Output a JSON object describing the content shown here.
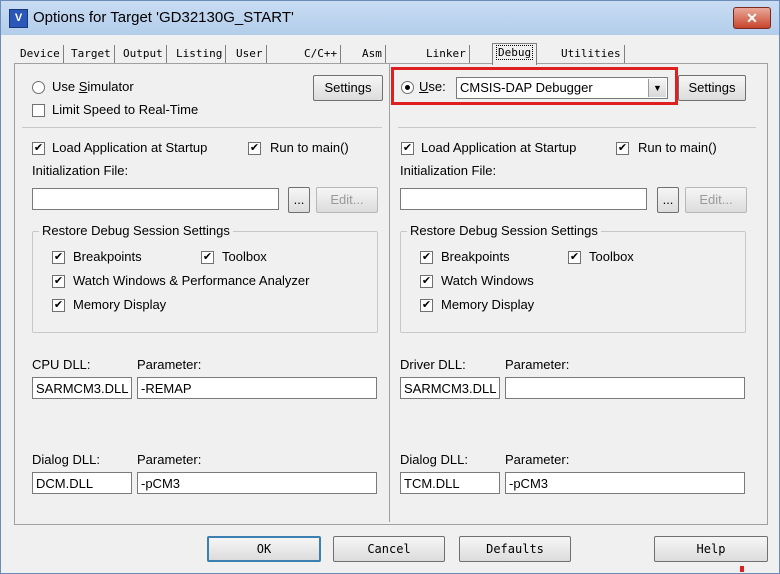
{
  "window": {
    "title": "Options for Target 'GD32130G_START'",
    "close_label": "✕",
    "app_icon_label": "V"
  },
  "tabs": [
    {
      "label": "Device",
      "active": false
    },
    {
      "label": "Target",
      "active": false
    },
    {
      "label": "Output",
      "active": false
    },
    {
      "label": "Listing",
      "active": false
    },
    {
      "label": "User",
      "active": false
    },
    {
      "label": "C/C++",
      "active": false
    },
    {
      "label": "Asm",
      "active": false
    },
    {
      "label": "Linker",
      "active": false
    },
    {
      "label": "Debug",
      "active": true
    },
    {
      "label": "Utilities",
      "active": false
    }
  ],
  "left": {
    "use_simulator": {
      "prefix": "Use ",
      "accel": "S",
      "rest": "imulator",
      "checked": false
    },
    "limit_speed": {
      "label": "Limit Speed to Real-Time",
      "checked": false
    },
    "settings_label": "Settings",
    "load_app": {
      "label": "Load Application at Startup",
      "checked": true
    },
    "run_to_main": {
      "label": "Run to main()",
      "checked": true
    },
    "init_file_label": "Initialization File:",
    "init_file_value": "",
    "browse_label": "...",
    "edit_label": "Edit...",
    "restore_group_title": "Restore Debug Session Settings",
    "breakpoints": {
      "label": "Breakpoints",
      "checked": true
    },
    "toolbox": {
      "label": "Toolbox",
      "checked": true
    },
    "watch_windows": {
      "label": "Watch Windows & Performance Analyzer",
      "checked": true
    },
    "memory_display": {
      "label": "Memory Display",
      "checked": true
    },
    "cpu_dll_label": "CPU DLL:",
    "cpu_dll_value": "SARMCM3.DLL",
    "cpu_param_label": "Parameter:",
    "cpu_param_value": "-REMAP",
    "dialog_dll_label": "Dialog DLL:",
    "dialog_dll_value": "DCM.DLL",
    "dialog_param_label": "Parameter:",
    "dialog_param_value": "-pCM3"
  },
  "right": {
    "use": {
      "accel": "U",
      "rest": "se:",
      "checked": true
    },
    "debugger_value": "CMSIS-DAP Debugger",
    "combo_arrow": "▼",
    "settings_label": "Settings",
    "load_app": {
      "label": "Load Application at Startup",
      "checked": true
    },
    "run_to_main": {
      "label": "Run to main()",
      "checked": true
    },
    "init_file_label": "Initialization File:",
    "init_file_value": "",
    "browse_label": "...",
    "edit_label": "Edit...",
    "restore_group_title": "Restore Debug Session Settings",
    "breakpoints": {
      "label": "Breakpoints",
      "checked": true
    },
    "toolbox": {
      "label": "Toolbox",
      "checked": true
    },
    "watch_windows": {
      "label": "Watch Windows",
      "checked": true
    },
    "memory_display": {
      "label": "Memory Display",
      "checked": true
    },
    "driver_dll_label": "Driver DLL:",
    "driver_dll_value": "SARMCM3.DLL",
    "driver_param_label": "Parameter:",
    "driver_param_value": "",
    "dialog_dll_label": "Dialog DLL:",
    "dialog_dll_value": "TCM.DLL",
    "dialog_param_label": "Parameter:",
    "dialog_param_value": "-pCM3"
  },
  "footer": {
    "ok_label": "OK",
    "cancel_label": "Cancel",
    "defaults_label": "Defaults",
    "help_label": "Help"
  },
  "check_glyph": "✔",
  "colors": {
    "highlight": "#e02020",
    "titlebar": "#b2cdea"
  }
}
